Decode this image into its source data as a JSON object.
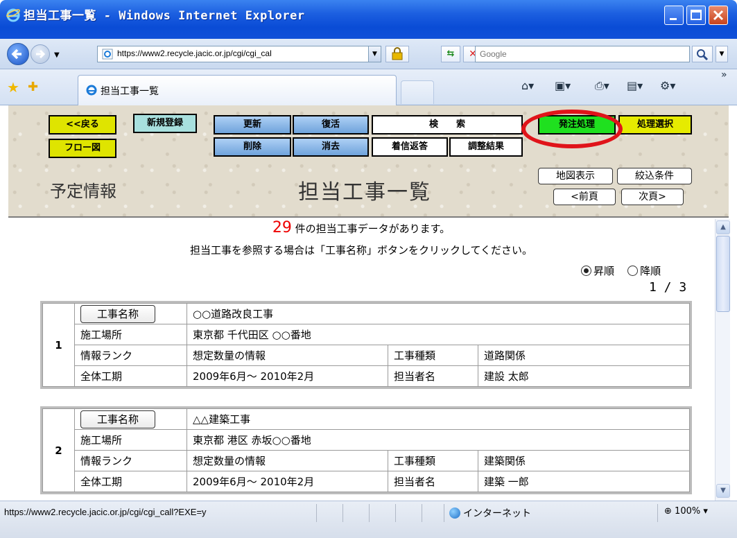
{
  "window": {
    "title": "担当工事一覧 - Windows Internet Explorer"
  },
  "address_bar": {
    "url": "https://www2.recycle.jacic.or.jp/cgi/cgi_cal",
    "search_placeholder": "Google"
  },
  "tab": {
    "label": "担当工事一覧"
  },
  "toolbar": {
    "back": "<<戻る",
    "new_register": "新規登録",
    "update": "更新",
    "restore": "復活",
    "search": "検　　索",
    "order_process": "発注処理",
    "process_select": "処理選択",
    "flow_chart": "フロー図",
    "delete": "削除",
    "erase": "消去",
    "incoming_reply": "着信返答",
    "adjust_result": "調整結果",
    "map_display": "地図表示",
    "filter_conditions": "絞込条件",
    "prev_page": "<前頁",
    "next_page": "次頁>"
  },
  "header": {
    "left_label": "予定情報",
    "page_title": "担当工事一覧"
  },
  "content": {
    "count": "29",
    "count_suffix": "件の担当工事データがあります。",
    "instruction": "担当工事を参照する場合は「工事名称」ボタンをクリックしてください。",
    "sort_asc": "昇順",
    "sort_desc": "降順",
    "page_indicator": "1 / 3"
  },
  "records": [
    {
      "no": "1",
      "name_button": "工事名称",
      "name": "○○道路改良工事",
      "location_label": "施工場所",
      "location": "東京都  千代田区  ○○番地",
      "rank_label": "情報ランク",
      "rank": "想定数量の情報",
      "type_label": "工事種類",
      "type": "道路関係",
      "period_label": "全体工期",
      "period": "2009年6月～ 2010年2月",
      "person_label": "担当者名",
      "person": "建設  太郎"
    },
    {
      "no": "2",
      "name_button": "工事名称",
      "name": "△△建築工事",
      "location_label": "施工場所",
      "location": "東京都  港区  赤坂○○番地",
      "rank_label": "情報ランク",
      "rank": "想定数量の情報",
      "type_label": "工事種類",
      "type": "建築関係",
      "period_label": "全体工期",
      "period": "2009年6月～ 2010年2月",
      "person_label": "担当者名",
      "person": "建築  一郎"
    }
  ],
  "status_bar": {
    "url": "https://www2.recycle.jacic.or.jp/cgi/cgi_call?EXE=y",
    "zone": "インターネット",
    "zoom": "100%"
  }
}
